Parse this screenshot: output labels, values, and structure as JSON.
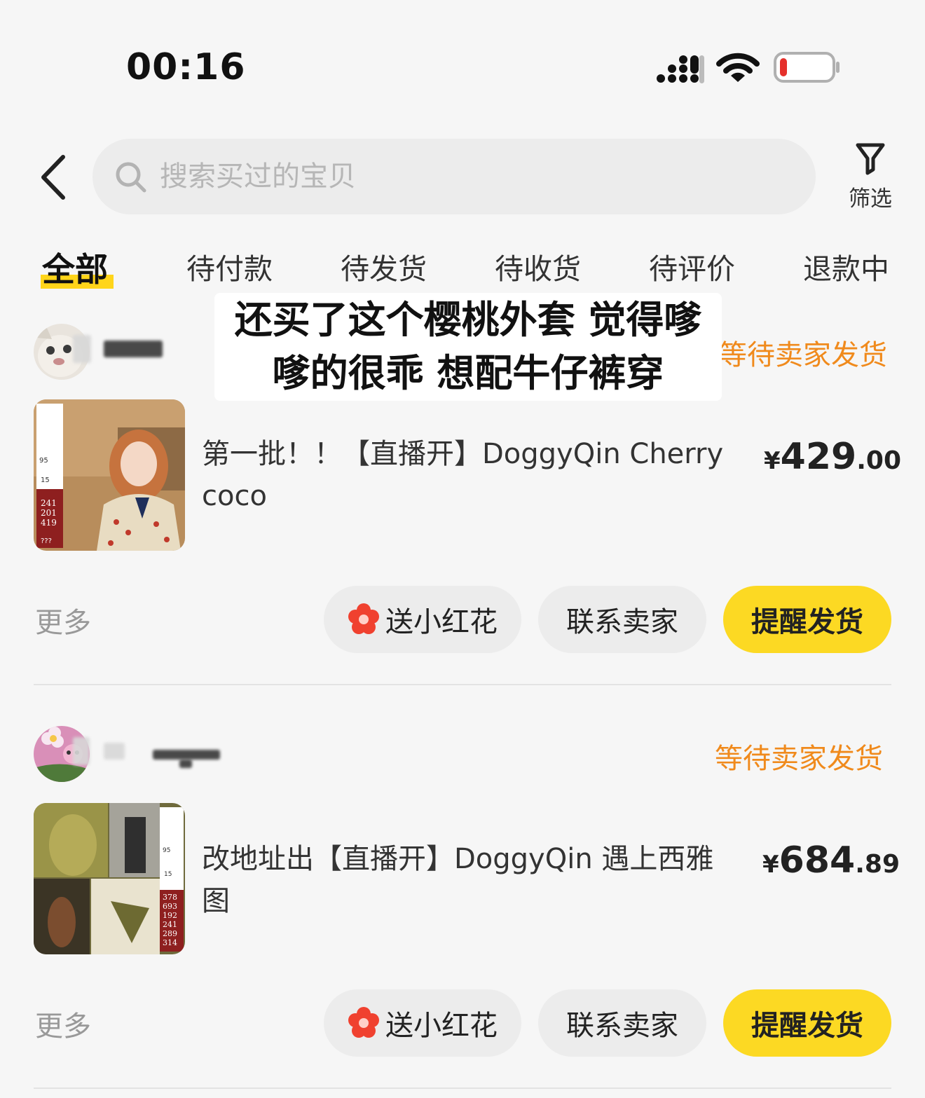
{
  "status_bar": {
    "time": "00:16",
    "battery_color": "#e5302b"
  },
  "header": {
    "search_placeholder": "搜索买过的宝贝",
    "filter_label": "筛选"
  },
  "tabs": [
    {
      "label": "全部",
      "active": true
    },
    {
      "label": "待付款"
    },
    {
      "label": "待发货"
    },
    {
      "label": "待收货"
    },
    {
      "label": "待评价"
    },
    {
      "label": "退款中"
    }
  ],
  "caption": "还买了这个樱桃外套 觉得嗲\n嗲的很乖 想配牛仔裤穿",
  "orders": [
    {
      "status": "等待卖家发货",
      "title": "第一批！！【直播开】DoggyQin Cherry coco",
      "price": {
        "currency": "¥",
        "integer": "429",
        "decimal": ".00"
      },
      "thumb_stats": [
        "95",
        "15",
        "241",
        "201",
        "419",
        "???"
      ],
      "more": "更多",
      "buttons": {
        "flower": "送小红花",
        "contact": "联系卖家",
        "remind": "提醒发货"
      }
    },
    {
      "status": "等待卖家发货",
      "title": "改地址出【直播开】DoggyQin 遇上西雅图",
      "price": {
        "currency": "¥",
        "integer": "684",
        "decimal": ".89"
      },
      "thumb_stats": [
        "95",
        "15",
        "378",
        "693",
        "192",
        "241",
        "289",
        "314"
      ],
      "more": "更多",
      "buttons": {
        "flower": "送小红花",
        "contact": "联系卖家",
        "remind": "提醒发货"
      }
    }
  ],
  "colors": {
    "accent": "#fcd923",
    "status": "#f08a1c",
    "flower": "#f0412f"
  }
}
